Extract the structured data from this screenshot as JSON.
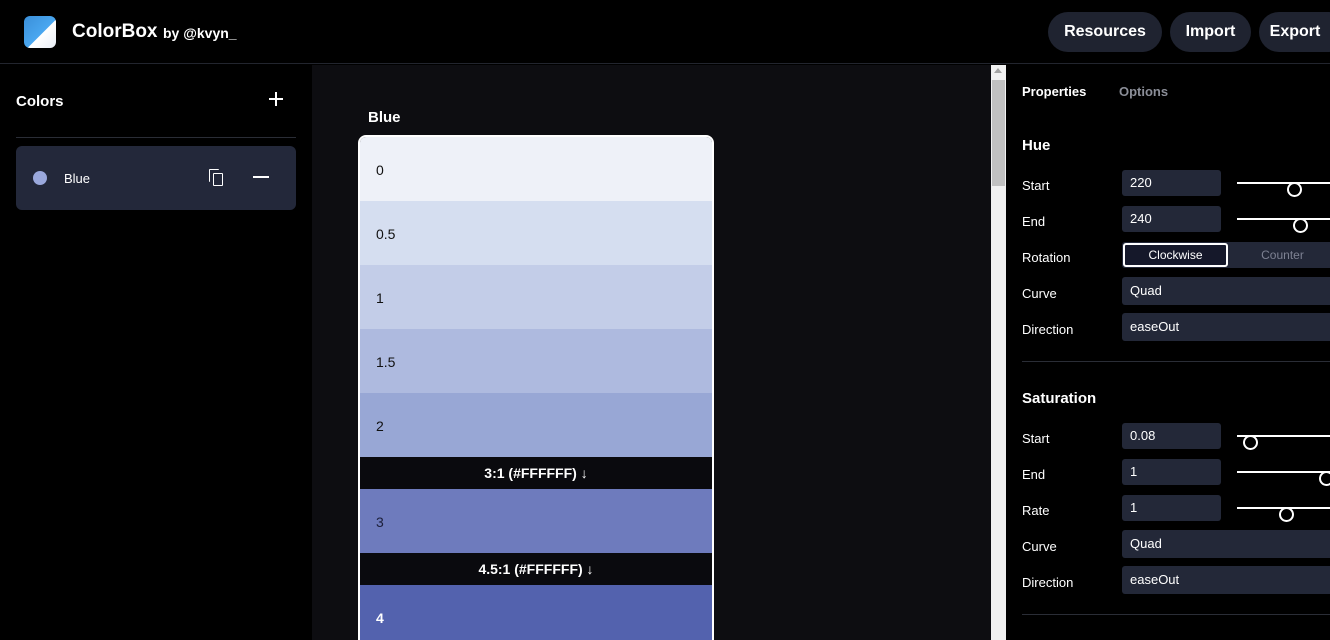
{
  "header": {
    "app_title": "ColorBox",
    "author": "by @kvyn_",
    "buttons": {
      "resources": "Resources",
      "import": "Import",
      "export": "Export"
    }
  },
  "sidebar": {
    "title": "Colors",
    "items": [
      {
        "label": "Blue",
        "dot_color": "#9aa8dc"
      }
    ]
  },
  "palette": {
    "name": "Blue",
    "steps": [
      {
        "label": "0",
        "color": "#eef1f8"
      },
      {
        "label": "0.5",
        "color": "#d5def0"
      },
      {
        "label": "1",
        "color": "#c3cde8"
      },
      {
        "label": "1.5",
        "color": "#aebadf"
      },
      {
        "label": "2",
        "color": "#98a7d5"
      },
      {
        "label": "3",
        "color": "#6e7bbd"
      },
      {
        "label": "4",
        "color": "#5362ae"
      }
    ],
    "contrast_markers": [
      "3:1 (#FFFFFF) ↓",
      "4.5:1 (#FFFFFF) ↓"
    ]
  },
  "panel": {
    "tabs": {
      "properties": "Properties",
      "options": "Options"
    },
    "hue": {
      "title": "Hue",
      "start_label": "Start",
      "start_value": "220",
      "end_label": "End",
      "end_value": "240",
      "rotation_label": "Rotation",
      "rotation_options": {
        "clockwise": "Clockwise",
        "counter": "Counter"
      },
      "rotation_selected": "Clockwise",
      "curve_label": "Curve",
      "curve_value": "Quad",
      "direction_label": "Direction",
      "direction_value": "easeOut"
    },
    "saturation": {
      "title": "Saturation",
      "start_label": "Start",
      "start_value": "0.08",
      "end_label": "End",
      "end_value": "1",
      "rate_label": "Rate",
      "rate_value": "1",
      "curve_label": "Curve",
      "curve_value": "Quad",
      "direction_label": "Direction",
      "direction_value": "easeOut"
    }
  }
}
